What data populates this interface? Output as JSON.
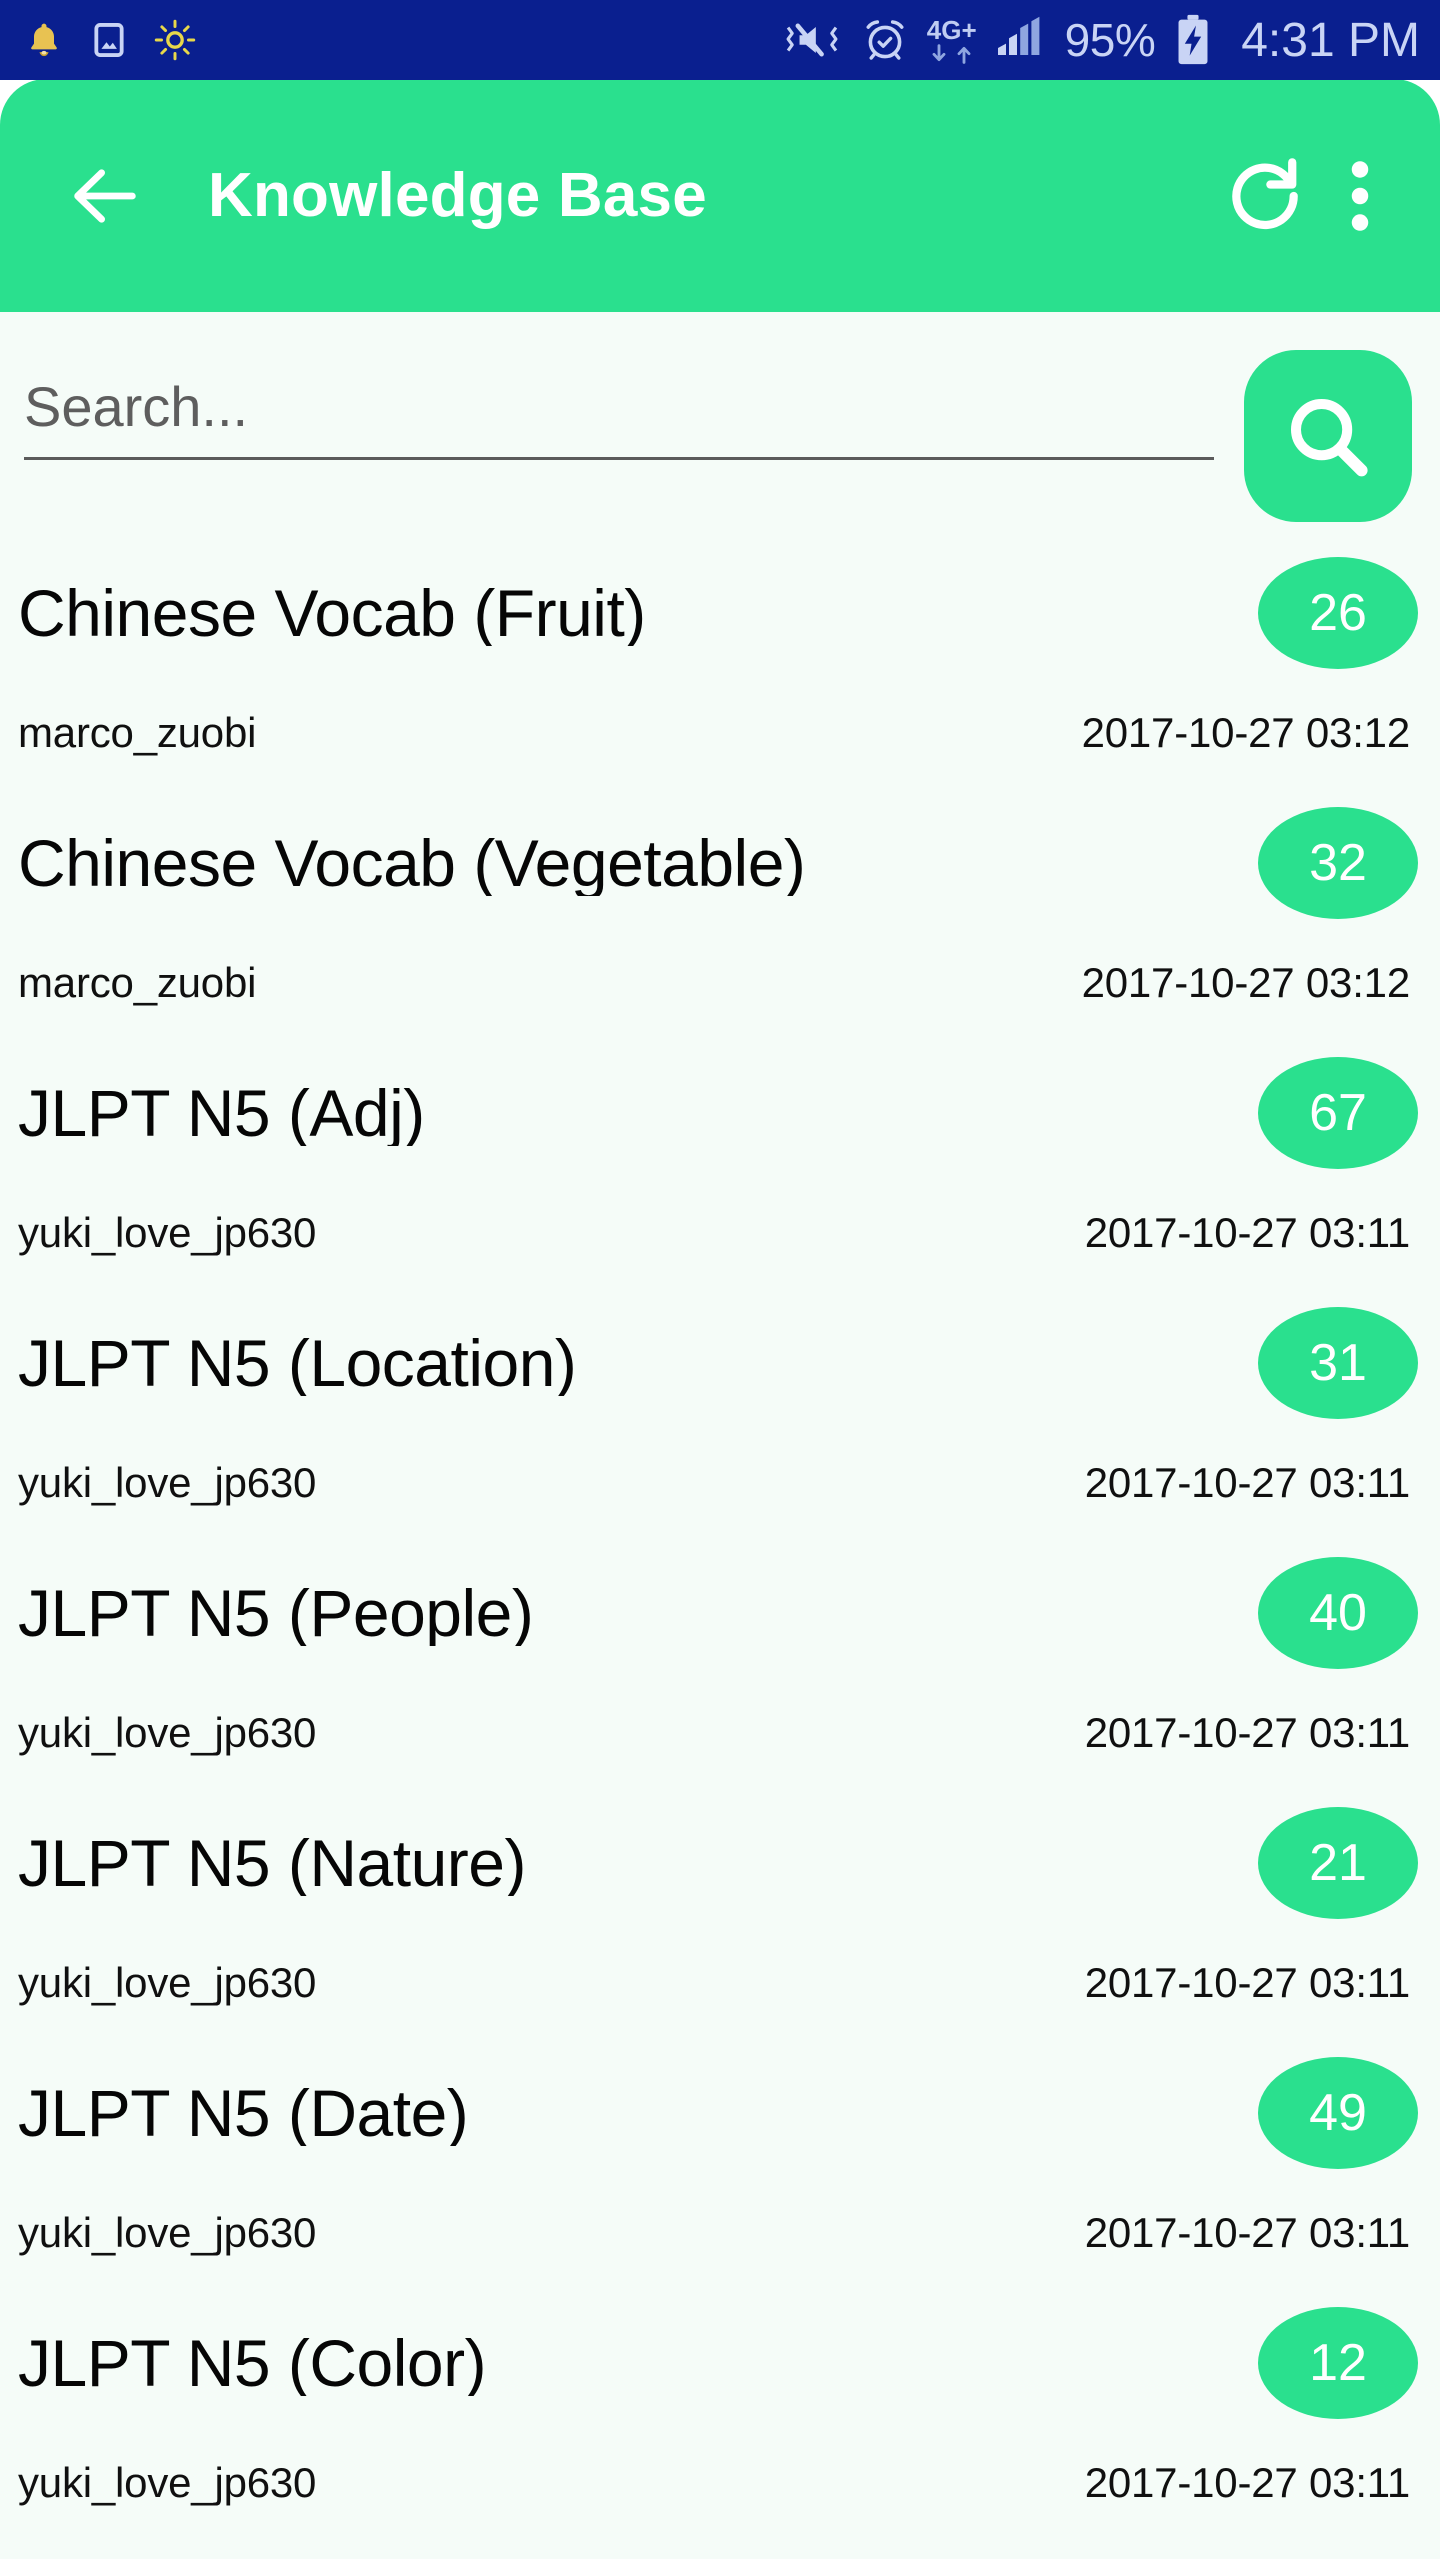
{
  "status_bar": {
    "background_color": "#0A1F8F",
    "text_color": "#C9D4F5",
    "left_icons": [
      "bell-icon",
      "image-icon",
      "brightness-sun-icon"
    ],
    "right_icons": [
      "vibrate-mute-icon",
      "alarm-clock-icon",
      "signal-bars-icon",
      "battery-charging-icon"
    ],
    "network_label": "4G+",
    "battery_percent": "95%",
    "clock": "4:31 PM"
  },
  "appbar": {
    "background_color": "#2AE08E",
    "title": "Knowledge Base",
    "back_icon": "arrow-left-icon",
    "refresh_icon": "refresh-icon",
    "overflow_icon": "more-vertical-icon"
  },
  "search": {
    "placeholder": "Search...",
    "value": "",
    "button_icon": "search-icon",
    "button_color": "#2AE08E"
  },
  "list": {
    "background_color": "#F5FCF8",
    "badge_color": "#2AE08E",
    "items": [
      {
        "title": "Chinese Vocab (Fruit)",
        "count": "26",
        "author": "marco_zuobi",
        "date": "2017-10-27 03:12"
      },
      {
        "title": "Chinese Vocab (Vegetable)",
        "count": "32",
        "author": "marco_zuobi",
        "date": "2017-10-27 03:12"
      },
      {
        "title": "JLPT N5 (Adj)",
        "count": "67",
        "author": "yuki_love_jp630",
        "date": "2017-10-27 03:11"
      },
      {
        "title": "JLPT N5 (Location)",
        "count": "31",
        "author": "yuki_love_jp630",
        "date": "2017-10-27 03:11"
      },
      {
        "title": "JLPT N5 (People)",
        "count": "40",
        "author": "yuki_love_jp630",
        "date": "2017-10-27 03:11"
      },
      {
        "title": "JLPT N5 (Nature)",
        "count": "21",
        "author": "yuki_love_jp630",
        "date": "2017-10-27 03:11"
      },
      {
        "title": "JLPT N5 (Date)",
        "count": "49",
        "author": "yuki_love_jp630",
        "date": "2017-10-27 03:11"
      },
      {
        "title": "JLPT N5 (Color)",
        "count": "12",
        "author": "yuki_love_jp630",
        "date": "2017-10-27 03:11"
      }
    ]
  }
}
